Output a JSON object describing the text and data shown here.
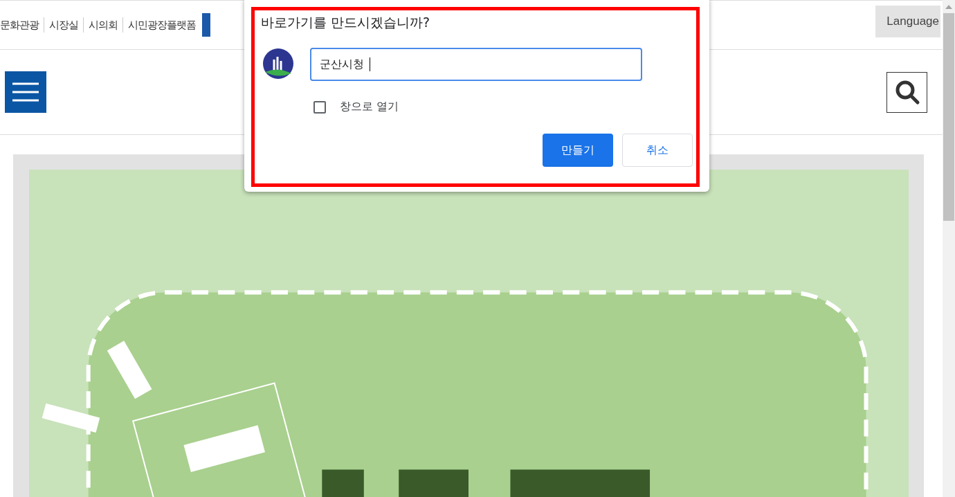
{
  "top_nav": {
    "items": [
      {
        "label": "문화관광"
      },
      {
        "label": "시장실"
      },
      {
        "label": "시의회"
      },
      {
        "label": "시민광장플랫폼"
      }
    ],
    "language_button": "Language"
  },
  "dialog": {
    "title": "바로가기를 만드시겠습니까?",
    "name_field": {
      "value": "군산시청"
    },
    "open_as_window": {
      "label": "창으로 열기",
      "checked": false
    },
    "buttons": [
      {
        "label": "만들기",
        "kind": "primary"
      },
      {
        "label": "취소",
        "kind": "secondary"
      }
    ]
  }
}
